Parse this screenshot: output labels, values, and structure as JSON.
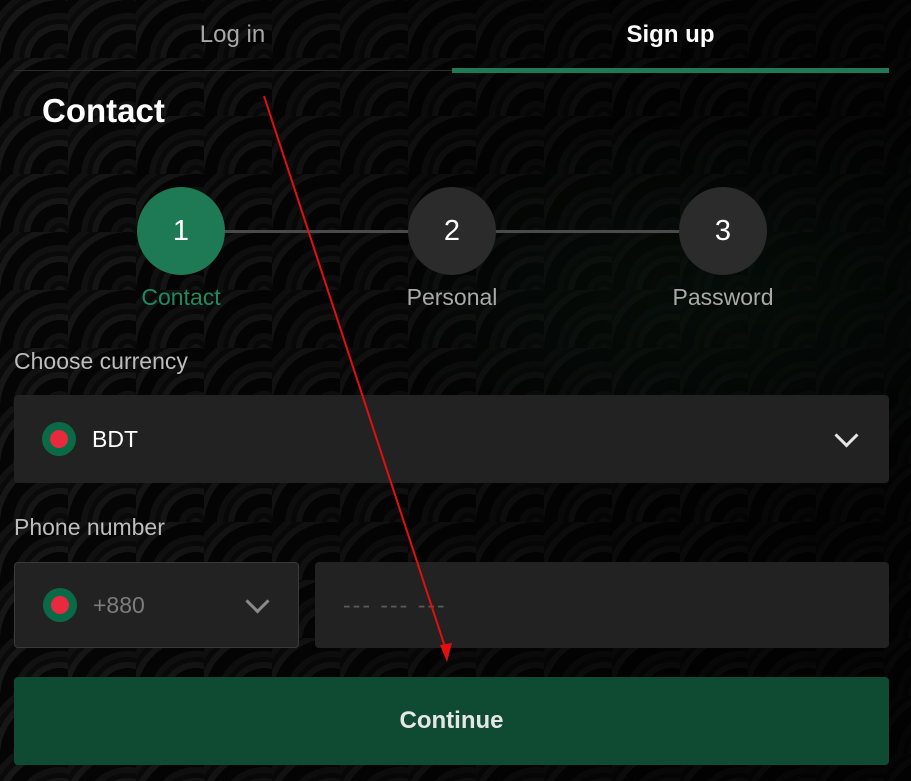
{
  "tabs": [
    {
      "label": "Log in",
      "active": false
    },
    {
      "label": "Sign up",
      "active": true
    }
  ],
  "section_title": "Contact",
  "steps": [
    {
      "number": "1",
      "label": "Contact",
      "active": true
    },
    {
      "number": "2",
      "label": "Personal",
      "active": false
    },
    {
      "number": "3",
      "label": "Password",
      "active": false
    }
  ],
  "currency": {
    "label": "Choose currency",
    "value": "BDT",
    "flag_icon": "bangladesh-flag-icon"
  },
  "phone": {
    "label": "Phone number",
    "code": "+880",
    "placeholder": "--- --- ---",
    "flag_icon": "bangladesh-flag-icon"
  },
  "continue_label": "Continue",
  "colors": {
    "accent": "#1d7a55",
    "button": "#0f4a33",
    "annotation": "#e01010"
  }
}
